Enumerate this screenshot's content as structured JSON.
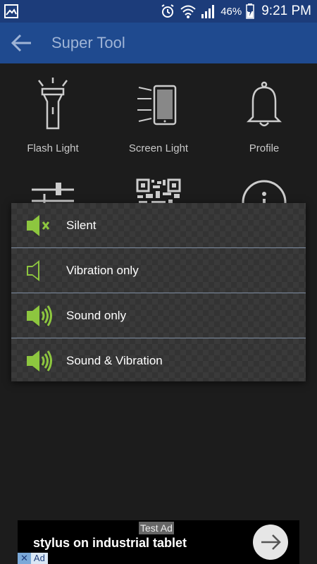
{
  "status_bar": {
    "battery_percent": "46%",
    "time": "9:21 PM",
    "icons": [
      "image-icon",
      "alarm-icon",
      "wifi-icon",
      "signal-icon",
      "battery-icon"
    ]
  },
  "app_bar": {
    "title": "Super Tool",
    "back_icon": "arrow-left-icon"
  },
  "tools": [
    {
      "label": "Flash Light",
      "icon": "flashlight-icon"
    },
    {
      "label": "Screen Light",
      "icon": "screen-light-icon"
    },
    {
      "label": "Profile",
      "icon": "bell-icon"
    },
    {
      "label": "",
      "icon": "sliders-icon"
    },
    {
      "label": "",
      "icon": "qr-code-icon"
    },
    {
      "label": "",
      "icon": "info-icon"
    }
  ],
  "profile_dialog": {
    "options": [
      {
        "label": "Silent",
        "icon": "speaker-muted-icon"
      },
      {
        "label": "Vibration only",
        "icon": "speaker-icon"
      },
      {
        "label": "Sound only",
        "icon": "speaker-sound-icon"
      },
      {
        "label": "Sound & Vibration",
        "icon": "speaker-sound-icon"
      }
    ],
    "accent_color": "#8dc63f"
  },
  "ad": {
    "badge": "Test Ad",
    "headline": "stylus on industrial tablet",
    "adchoices_x": "✕",
    "adchoices_label": "Ad"
  }
}
